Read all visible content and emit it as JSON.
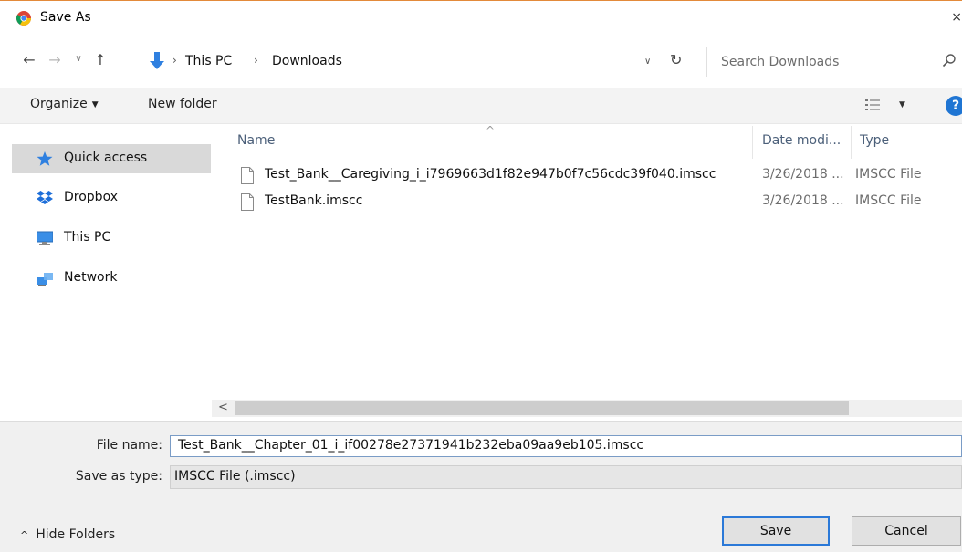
{
  "window": {
    "title": "Save As",
    "close_glyph": "×",
    "icon": "chrome-icon"
  },
  "nav": {
    "back": "←",
    "forward": "→",
    "recent": "∨",
    "up": "↑"
  },
  "address": {
    "crumbs": [
      "This PC",
      "Downloads"
    ],
    "separator": "›",
    "dropdown": "∨",
    "refresh": "↻"
  },
  "search": {
    "placeholder": "Search Downloads",
    "icon": "search-icon"
  },
  "toolbar": {
    "organize_label": "Organize",
    "organize_caret": "▼",
    "new_folder_label": "New folder",
    "view_caret": "▼",
    "help": "?"
  },
  "sidebar": {
    "items": [
      {
        "label": "Quick access",
        "icon": "star-icon",
        "selected": true
      },
      {
        "label": "Dropbox",
        "icon": "dropbox-icon",
        "selected": false
      },
      {
        "label": "This PC",
        "icon": "computer-icon",
        "selected": false
      },
      {
        "label": "Network",
        "icon": "network-icon",
        "selected": false
      }
    ]
  },
  "filelist": {
    "sort_indicator": "^",
    "columns": {
      "name": "Name",
      "date": "Date modi...",
      "type": "Type"
    },
    "rows": [
      {
        "name": "Test_Bank__Caregiving_i_i7969663d1f82e947b0f7c56cdc39f040.imscc",
        "date": "3/26/2018 ...",
        "type": "IMSCC File"
      },
      {
        "name": "TestBank.imscc",
        "date": "3/26/2018 ...",
        "type": "IMSCC File"
      }
    ]
  },
  "scrollbar": {
    "left_arrow": "<"
  },
  "form": {
    "file_name_label": "File name:",
    "file_name_value": "Test_Bank__Chapter_01_i_if00278e27371941b232eba09aa9eb105.imscc",
    "save_as_type_label": "Save as type:",
    "save_as_type_value": "IMSCC File (.imscc)"
  },
  "footer": {
    "hide_folders_label": "Hide Folders",
    "hide_folders_chevron": "^",
    "save_label": "Save",
    "cancel_label": "Cancel"
  },
  "colors": {
    "accent": "#2b79d8",
    "selected_bg": "#d9d9d9",
    "help_blue": "#1f75d3",
    "title_border": "#e38a3a"
  }
}
